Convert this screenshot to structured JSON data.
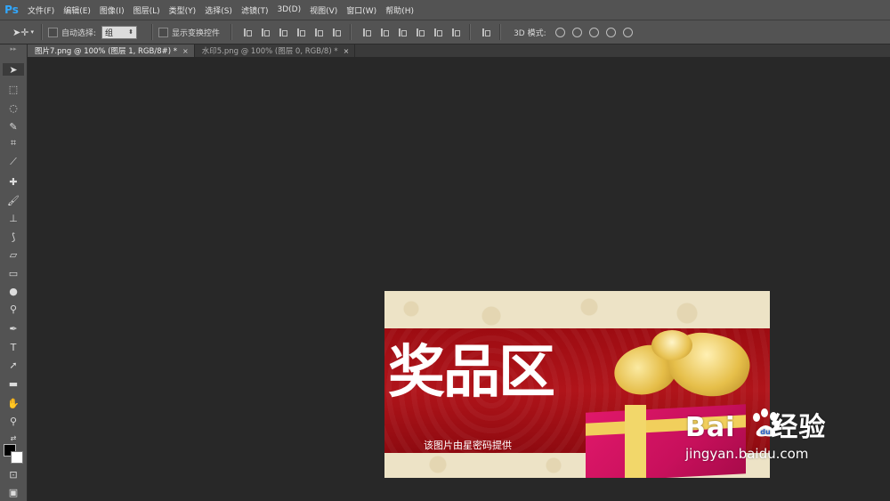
{
  "app": {
    "logo": "Ps"
  },
  "menu": [
    "文件(F)",
    "编辑(E)",
    "图像(I)",
    "图层(L)",
    "类型(Y)",
    "选择(S)",
    "滤镜(T)",
    "3D(D)",
    "视图(V)",
    "窗口(W)",
    "帮助(H)"
  ],
  "options": {
    "auto_select_label": "自动选择:",
    "auto_select_value": "组",
    "show_transform_label": "显示变换控件",
    "mode_3d_label": "3D 模式:"
  },
  "tabs": [
    {
      "label": "图片7.png @ 100% (图层 1, RGB/8#) *",
      "active": true
    },
    {
      "label": "水印5.png @ 100% (图层 0, RGB/8) *",
      "active": false
    }
  ],
  "canvas": {
    "title": "奖品区",
    "subtitle": "该图片由星密码提供"
  },
  "watermark": {
    "brand": "Bai",
    "brand_suffix": "经验",
    "url": "jingyan.baidu.com"
  },
  "colors": {
    "accent": "#31a8ff",
    "banner_red": "#9d0c12"
  }
}
